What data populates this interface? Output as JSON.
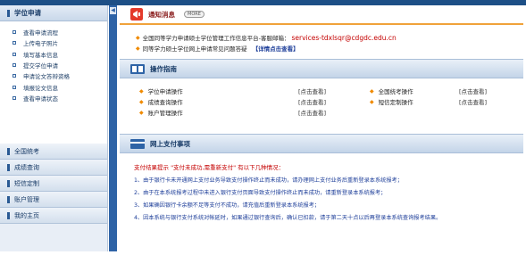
{
  "topbar": {
    "text": ""
  },
  "sidebar": {
    "header": "学位申请",
    "sub_items": [
      "查看申请流程",
      "上传电子照片",
      "填写基本信息",
      "提交学位申请",
      "申请论文答辩资格",
      "填报论文信息",
      "查看申请状态"
    ],
    "items": [
      "全国统考",
      "成绩查询",
      "短信定制",
      "账户管理",
      "我的主页"
    ]
  },
  "notice": {
    "title": "通知消息",
    "more": "MORE",
    "line1": "全国同等学力申请硕士学位管理工作信息平台-客服邮箱：",
    "email": "services-tdxlsqr@cdgdc.edu.cn",
    "line2": "同等学力硕士学位网上申请常见问题答疑",
    "line2_link": "【详情点击查看】"
  },
  "guide": {
    "title": "操作指南",
    "rows": [
      {
        "left": "学位申请操作",
        "left_view": "[点击查看]",
        "right": "全国统考操作",
        "right_view": "[点击查看]"
      },
      {
        "left": "成绩查询操作",
        "left_view": "[点击查看]",
        "right": "短信定制操作",
        "right_view": "[点击查看]"
      },
      {
        "left": "账户管理操作",
        "left_view": "[点击查看]",
        "right": "",
        "right_view": ""
      }
    ]
  },
  "payment": {
    "title": "网上支付事项",
    "head": "支付结果提示 \"支付未成功,需重新支付\" 有以下几种情况：",
    "items": [
      "1、由于银行卡未开通网上支付业务导致支付操作终止而未成功，请办理网上支付业务后重新登录本系统报考；",
      "2、由于在本系统报考过程中未进入银行支付页面导致支付操作终止而未成功，请重新登录本系统报考；",
      "3、如果确因银行卡余额不足等支付不成功，请充值后重新登录本系统报考；",
      "4、因本系统与银行支付系统对帐延时，如果通过银行查询后，确认已扣款，请于第二天十点以后再登录本系统查询报考结果。"
    ]
  },
  "colors": {
    "accent": "#2e63a6",
    "notice_red": "#c40000",
    "link_blue": "#1d3e99",
    "orange": "#f0a23a"
  }
}
